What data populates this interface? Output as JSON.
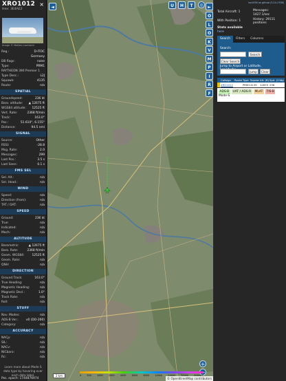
{
  "info": {
    "callsign": "XRO1012",
    "hex_label": "Hex:",
    "hex": "3E4AE2",
    "close": "×",
    "photo_credit": "Image © Matteo Lamberti",
    "base_rows": [
      {
        "k": "Reg.:",
        "v": "D-ITOC"
      },
      {
        "k": "",
        "v": "Germany"
      },
      {
        "k": "DB flags:",
        "v": "none"
      },
      {
        "k": "Type:",
        "v": "PRM1"
      },
      {
        "k": "RAYTHEON 390 Premier 1",
        "v": ""
      },
      {
        "k": "Type Desc.:",
        "v": "L2J"
      },
      {
        "k": "Squawk:",
        "v": "4135"
      },
      {
        "k": "Route:",
        "v": "n/a"
      }
    ],
    "sections": [
      {
        "title": "SPATIAL",
        "rows": [
          {
            "k": "Groundspeed:",
            "v": "236 kt"
          },
          {
            "k": "Baro. altitude:",
            "v": "▲ 12675 ft"
          },
          {
            "k": "WGS84 altitude:",
            "v": "12525 ft"
          },
          {
            "k": "Vert. Rate:",
            "v": "2368 ft/min"
          },
          {
            "k": "Track:",
            "v": "163.0°"
          },
          {
            "k": "Pos.:",
            "v": "51.610°, 6.155°"
          },
          {
            "k": "Distance:",
            "v": "94.5 nmi"
          }
        ]
      },
      {
        "title": "SIGNAL",
        "rows": [
          {
            "k": "Source:",
            "v": "Other"
          },
          {
            "k": "RSSI:",
            "v": "-28.8"
          },
          {
            "k": "Msg. Rate:",
            "v": "2.0"
          },
          {
            "k": "Messages:",
            "v": "299"
          },
          {
            "k": "Last Pos.:",
            "v": "3.5 s"
          },
          {
            "k": "Last Seen:",
            "v": "0.1 s"
          }
        ]
      },
      {
        "title": "FMS SEL",
        "rows": [
          {
            "k": "Sel. Alt.:",
            "v": "n/a"
          },
          {
            "k": "Sel. Head.:",
            "v": "n/a"
          }
        ]
      },
      {
        "title": "WIND",
        "rows": [
          {
            "k": "Speed:",
            "v": "n/a"
          },
          {
            "k": "Direction (from):",
            "v": "n/a"
          },
          {
            "k": "TAT / OAT:",
            "v": "n/a"
          }
        ]
      },
      {
        "title": "SPEED",
        "rows": [
          {
            "k": "Ground:",
            "v": "236 kt"
          },
          {
            "k": "True:",
            "v": "n/a"
          },
          {
            "k": "Indicated:",
            "v": "n/a"
          },
          {
            "k": "Mach:",
            "v": "n/a"
          }
        ]
      },
      {
        "title": "ALTITUDE",
        "rows": [
          {
            "k": "Barometric:",
            "v": "▲ 12675 ft"
          },
          {
            "k": "Baro. Rate:",
            "v": "2368 ft/min"
          },
          {
            "k": "Geom. WGS84:",
            "v": "12525 ft"
          },
          {
            "k": "Geom. Rate:",
            "v": "n/a"
          },
          {
            "k": "QNH:",
            "v": "n/a"
          }
        ]
      },
      {
        "title": "DIRECTION",
        "rows": [
          {
            "k": "Ground Track:",
            "v": "163.0°"
          },
          {
            "k": "True Heading:",
            "v": "n/a"
          },
          {
            "k": "Magnetic Heading:",
            "v": "n/a"
          },
          {
            "k": "Magnetic Decl.:",
            "v": "1.0°"
          },
          {
            "k": "Track Rate:",
            "v": "n/a"
          },
          {
            "k": "Roll:",
            "v": "n/a"
          }
        ]
      },
      {
        "title": "STUFF",
        "rows": [
          {
            "k": "Nav. Modes:",
            "v": "n/a"
          },
          {
            "k": "ADS-B Ver.:",
            "v": "v0 (DO-260)"
          },
          {
            "k": "Category:",
            "v": "n/a"
          }
        ]
      },
      {
        "title": "ACCURACY",
        "rows": [
          {
            "k": "NACp:",
            "v": "n/a"
          },
          {
            "k": "SIL:",
            "v": "n/a"
          },
          {
            "k": "NACv:",
            "v": "n/a"
          },
          {
            "k": "NICbaro:",
            "v": "n/a"
          },
          {
            "k": "Rc:",
            "v": "n/a"
          }
        ]
      }
    ],
    "note": "Learn more about Mode S data type by hovering over each data label.",
    "pos_epoch": "Pos. epoch:   1744876974"
  },
  "map": {
    "top_buttons": [
      "U",
      "H",
      "T"
    ],
    "side_buttons": [
      "O",
      "L",
      "O",
      "K",
      "V",
      "M",
      "P",
      "I",
      "R",
      "F"
    ],
    "left_arrow": "◄",
    "right_arrow": "►",
    "zoom_in": "+",
    "zoom_out": "−",
    "scale": "2 km",
    "attribution": "© OpenStreetMap contributors",
    "altitude_ticks": [
      "0",
      "500",
      "1000",
      "2000",
      "4000",
      "6000",
      "8000",
      "10000",
      "20000",
      "30000",
      "40000+"
    ]
  },
  "right_panel": {
    "top_link": "tar1090 on github (3.14.1706)",
    "stats": {
      "total_label": "Total Aircraft:",
      "total": "1",
      "messages_label": "Messages:",
      "messages": "1427.1/sec",
      "with_pos_label": "With Position:",
      "with_pos": "1",
      "history_label": "History:",
      "history": "29111 positions",
      "stats_label": "Stats available",
      "stats_link": "here"
    },
    "tabs": [
      "Search",
      "Filters",
      "Columns"
    ],
    "search": {
      "label": "Search:",
      "button": "Search",
      "clear": "Clear Search",
      "jump_label": "Jump to Airport or Latitude, Longitude:",
      "jump_button": "Jump",
      "clear2": "Clear"
    },
    "table": {
      "headers": [
        "",
        "Callsign",
        "Route",
        "Type",
        "Squawk",
        "Alt. (ft)",
        "Spd. (kt)",
        "Hdg"
      ],
      "row": [
        "",
        "XRO1012",
        "",
        "PRM1",
        "4135",
        "12675",
        "236",
        ""
      ]
    },
    "legend": [
      "ADS-B",
      "UAT / ADS-R",
      "MLAT",
      "TIS-B",
      "Mode-S"
    ]
  },
  "colors": {
    "panel": "#262626",
    "accent": "#1e5c8e",
    "adsb": "#c6f0b4",
    "uat": "#d7e8c0",
    "mlat": "#f5d29b",
    "tisb": "#f0b2a6"
  }
}
